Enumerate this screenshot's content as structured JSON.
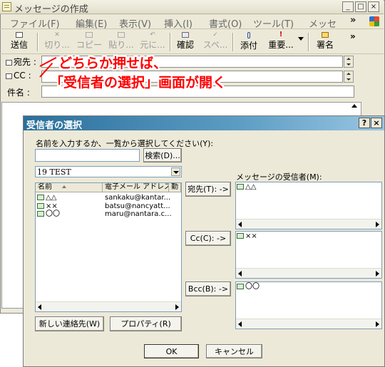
{
  "compose": {
    "title": "メッセージの作成",
    "window_buttons": [
      "_",
      "□",
      "×"
    ],
    "menu": [
      "ファイル(F)",
      "編集(E)",
      "表示(V)",
      "挿入(I)",
      "書式(O)",
      "ツール(T)",
      "メッセ"
    ],
    "menu_more": "»",
    "toolbar": {
      "send": "送信",
      "cut": "切り...",
      "copy": "コピー",
      "paste": "貼り...",
      "undo": "元に...",
      "check": "確認",
      "spell": "スペ...",
      "attach": "添付",
      "priority": "重要...",
      "sign": "署名",
      "more": "»"
    },
    "fields": {
      "to_label": "宛先 :",
      "cc_label": "CC :",
      "subject_label": "件名 :"
    }
  },
  "annotation": {
    "line1": "どちらか押せば、",
    "line2": "「受信者の選択」画面が開く"
  },
  "dialog": {
    "title": "受信者の選択",
    "help_button": "?",
    "close_button": "×",
    "instruction": "名前を入力するか、一覧から選択してください(Y):",
    "search_input_value": "",
    "search_button": "検索(D)...",
    "address_book": "19 TEST",
    "columns": [
      "名前",
      "電子メール アドレス",
      "勤"
    ],
    "contacts": [
      {
        "name": "△△",
        "email": "sankaku@kantar..."
      },
      {
        "name": "××",
        "email": "batsu@nancyatt..."
      },
      {
        "name": "〇〇",
        "email": "maru@nantara.c..."
      }
    ],
    "to_button": "宛先(T): ->",
    "cc_button": "Cc(C): ->",
    "bcc_button": "Bcc(B): ->",
    "recipients_label": "メッセージの受信者(M):",
    "to_recipients": [
      "△△"
    ],
    "cc_recipients": [
      "××"
    ],
    "bcc_recipients": [
      "〇〇"
    ],
    "new_contact_button": "新しい連絡先(W)",
    "properties_button": "プロパティ(R)",
    "ok_button": "OK",
    "cancel_button": "キャンセル"
  }
}
